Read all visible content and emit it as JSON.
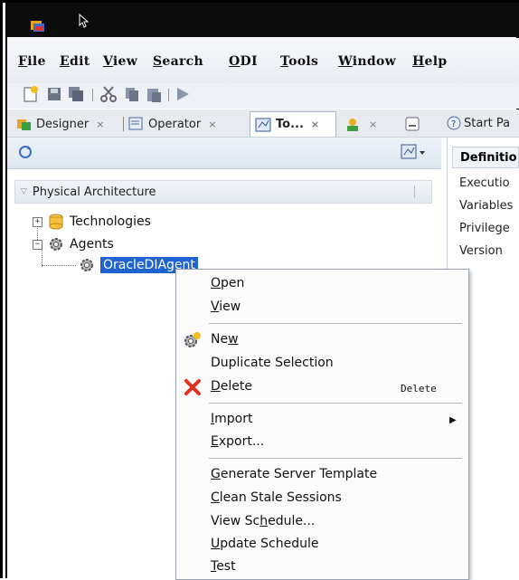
{
  "menubar": {
    "items": [
      {
        "label": "File",
        "mnemonic": "F",
        "rest": "ile"
      },
      {
        "label": "Edit",
        "mnemonic": "E",
        "rest": "dit"
      },
      {
        "label": "View",
        "mnemonic": "V",
        "rest": "iew"
      },
      {
        "label": "Search",
        "mnemonic": "S",
        "rest": "earch"
      },
      {
        "label": "ODI",
        "mnemonic": "O",
        "rest": "DI"
      },
      {
        "label": "Tools",
        "mnemonic": "T",
        "rest": "ools"
      },
      {
        "label": "Window",
        "mnemonic": "W",
        "rest": "indow"
      },
      {
        "label": "Help",
        "mnemonic": "H",
        "rest": "elp"
      }
    ]
  },
  "toolbar": {
    "icons": [
      "new-icon",
      "save-icon",
      "save-all-icon",
      "cut-icon",
      "copy-icon",
      "paste-icon",
      "run-icon"
    ]
  },
  "tabs": [
    {
      "label": "Designer",
      "close": "×"
    },
    {
      "label": "Operator",
      "close": "×"
    },
    {
      "label": "To...",
      "close": "×"
    },
    {
      "label": "",
      "close": "×"
    }
  ],
  "right_tab": {
    "label": "Start Pa"
  },
  "tree": {
    "section": "Physical Architecture",
    "nodes": [
      {
        "label": "Technologies",
        "expander": "+"
      },
      {
        "label": "Agents",
        "expander": "−"
      },
      {
        "label": "OracleDIAgent"
      }
    ]
  },
  "properties": {
    "header": "Definitio",
    "rows": [
      "Executio",
      "Variables",
      "Privilege",
      "Version"
    ]
  },
  "context_menu": {
    "items": [
      {
        "pre": "",
        "mn": "O",
        "post": "pen"
      },
      {
        "pre": "",
        "mn": "V",
        "post": "iew"
      },
      {
        "pre": "Ne",
        "mn": "w",
        "post": ""
      },
      {
        "pre": "Duplicate Selection",
        "mn": "",
        "post": ""
      },
      {
        "pre": "",
        "mn": "D",
        "post": "elete",
        "shortcut": "Delete"
      },
      {
        "pre": "",
        "mn": "I",
        "post": "mport"
      },
      {
        "pre": "",
        "mn": "E",
        "post": "xport..."
      },
      {
        "pre": "",
        "mn": "G",
        "post": "enerate Server Template"
      },
      {
        "pre": "",
        "mn": "C",
        "post": "lean Stale Sessions"
      },
      {
        "pre": "View Sc",
        "mn": "h",
        "post": "edule..."
      },
      {
        "pre": "",
        "mn": "U",
        "post": "pdate Schedule"
      },
      {
        "pre": "",
        "mn": "T",
        "post": "est"
      }
    ]
  }
}
